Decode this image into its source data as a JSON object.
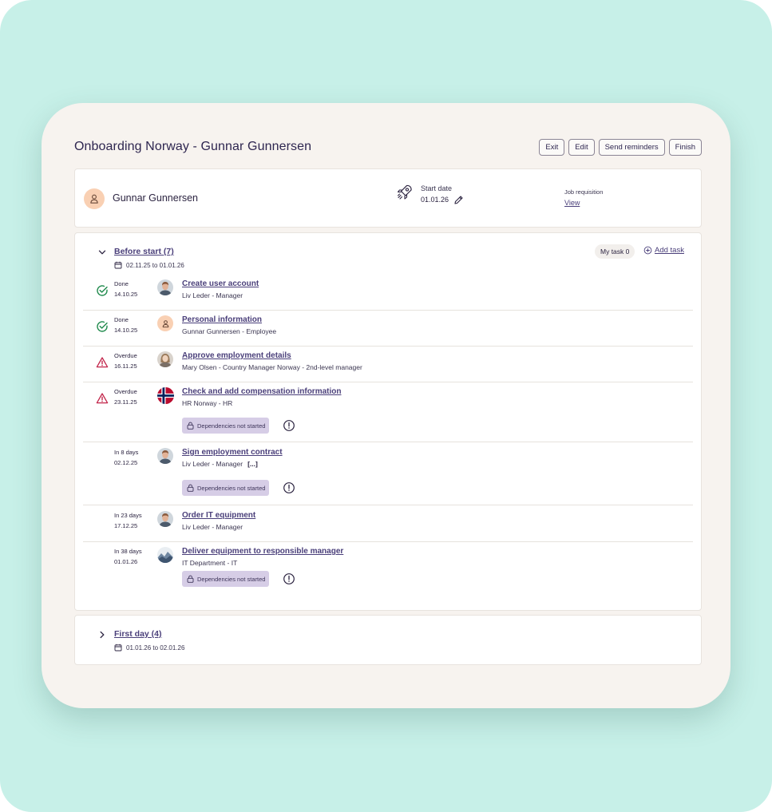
{
  "page": {
    "title": "Onboarding Norway - Gunnar Gunnersen",
    "actions": [
      "Exit",
      "Edit",
      "Send reminders",
      "Finish"
    ]
  },
  "employee": {
    "name": "Gunnar Gunnersen",
    "start_date_label": "Start date",
    "start_date": "01.01.26",
    "job_requisition_label": "Job requisition",
    "job_requisition_link": "View"
  },
  "phases": [
    {
      "title": "Before start (7)",
      "date_range": "02.11.25 to 01.01.26",
      "expanded": true,
      "my_task_label": "My task 0",
      "add_task_label": "Add task",
      "tasks": [
        {
          "status": "Done",
          "status_type": "done",
          "date": "14.10.25",
          "title": "Create user account",
          "assignee": "Liv Leder - Manager",
          "avatar": "photo-man"
        },
        {
          "status": "Done",
          "status_type": "done",
          "date": "14.10.25",
          "title": "Personal information",
          "assignee": "Gunnar Gunnersen - Employee",
          "avatar": "person-icon"
        },
        {
          "status": "Overdue",
          "status_type": "overdue",
          "date": "16.11.25",
          "title": "Approve employment details",
          "assignee": "Mary Olsen - Country Manager Norway - 2nd-level manager",
          "avatar": "photo-woman"
        },
        {
          "status": "Overdue",
          "status_type": "overdue",
          "date": "23.11.25",
          "title": "Check and add compensation information",
          "assignee": "HR Norway - HR",
          "avatar": "norway-flag",
          "badge": "Dependencies not started"
        },
        {
          "status": "In 8 days",
          "status_type": "pending",
          "date": "02.12.25",
          "title": "Sign employment contract",
          "assignee": "Liv Leder - Manager",
          "more": "[...]",
          "avatar": "photo-man",
          "badge": "Dependencies not started"
        },
        {
          "status": "In 23 days",
          "status_type": "pending",
          "date": "17.12.25",
          "title": "Order IT equipment",
          "assignee": "Liv Leder - Manager",
          "avatar": "photo-man"
        },
        {
          "status": "In 38 days",
          "status_type": "pending",
          "date": "01.01.26",
          "title": "Deliver equipment to responsible manager",
          "assignee": "IT Department - IT",
          "avatar": "photo-landscape",
          "badge": "Dependencies not started"
        }
      ]
    },
    {
      "title": "First day (4)",
      "date_range": "01.01.26 to 02.01.26",
      "expanded": false
    }
  ],
  "colors": {
    "background": "#c7f0e8",
    "card": "#f7f3ef",
    "link": "#4a3f7a",
    "done": "#1f8a4c",
    "overdue": "#c2264b",
    "badge": "#d6cde6",
    "avatar_peach": "#f9d0b3"
  },
  "icons": {
    "start": "rocket-icon",
    "edit": "pencil-icon",
    "calendar": "calendar-icon",
    "expanded": "chevron-down-icon",
    "collapsed": "chevron-right-icon",
    "add": "plus-circle-icon",
    "done": "check-circle-icon",
    "overdue": "warning-triangle-icon",
    "lock": "lock-icon",
    "info": "info-circle-icon"
  }
}
